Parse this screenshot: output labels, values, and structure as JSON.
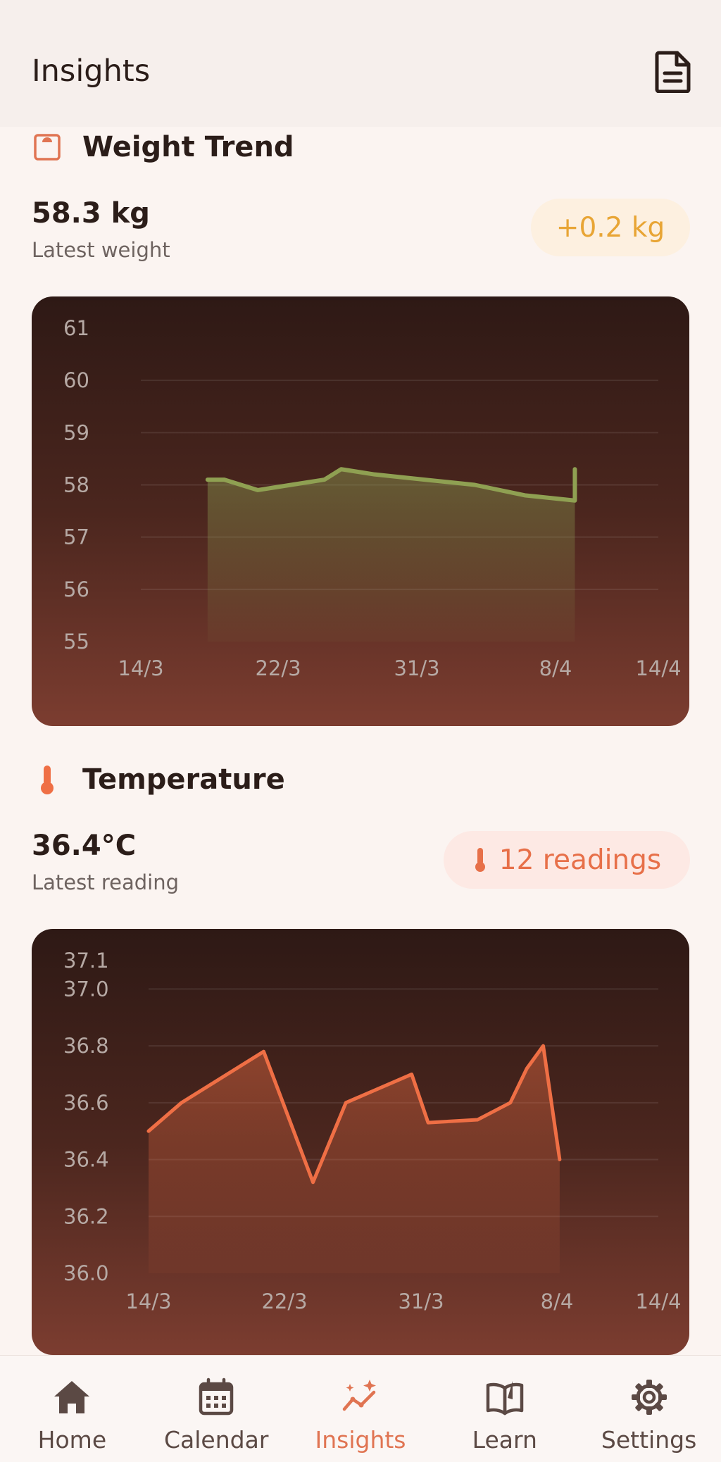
{
  "header": {
    "title": "Insights",
    "report_icon": "document-icon"
  },
  "weight": {
    "section_title": "Weight Trend",
    "icon": "scale-icon",
    "value": "58.3 kg",
    "label": "Latest weight",
    "change_badge": "+0.2 kg",
    "accent_color": "#8fa052",
    "badge_color": "#e8a535"
  },
  "temperature": {
    "section_title": "Temperature",
    "icon": "thermometer-icon",
    "value": "36.4°C",
    "label": "Latest reading",
    "readings_badge": "12 readings",
    "accent_color": "#ef6f45"
  },
  "chart_data": [
    {
      "type": "area",
      "title": "",
      "xlabel": "",
      "ylabel": "",
      "x_ticks": [
        "14/3",
        "22/3",
        "31/3",
        "8/4",
        "14/4"
      ],
      "y_ticks": [
        "61",
        "60",
        "59",
        "58",
        "57",
        "56",
        "55"
      ],
      "ylim": [
        55,
        61
      ],
      "xlim": [
        "2024-03-14",
        "2024-04-14"
      ],
      "grid": true,
      "series": [
        {
          "x": [
            "2024-03-18",
            "2024-03-19",
            "2024-03-21",
            "2024-03-23",
            "2024-03-25",
            "2024-03-26",
            "2024-03-28",
            "2024-03-31",
            "2024-04-03",
            "2024-04-06",
            "2024-04-09",
            "2024-04-09"
          ],
          "y": [
            58.1,
            58.1,
            57.9,
            58.0,
            58.1,
            58.3,
            58.2,
            58.1,
            58.0,
            57.8,
            57.7,
            58.3
          ]
        }
      ]
    },
    {
      "type": "area",
      "title": "",
      "xlabel": "",
      "ylabel": "",
      "x_ticks": [
        "14/3",
        "22/3",
        "31/3",
        "8/4",
        "14/4"
      ],
      "y_ticks": [
        "37.1",
        "37.0",
        "36.8",
        "36.6",
        "36.4",
        "36.2",
        "36.0"
      ],
      "ylim": [
        36.0,
        37.1
      ],
      "xlim": [
        "2024-03-14",
        "2024-04-14"
      ],
      "grid": true,
      "series": [
        {
          "x": [
            "2024-03-14",
            "2024-03-16",
            "2024-03-21",
            "2024-03-24",
            "2024-03-26",
            "2024-03-30",
            "2024-03-31",
            "2024-04-03",
            "2024-04-05",
            "2024-04-06",
            "2024-04-07",
            "2024-04-08"
          ],
          "y": [
            36.5,
            36.6,
            36.78,
            36.32,
            36.6,
            36.7,
            36.53,
            36.54,
            36.6,
            36.72,
            36.8,
            36.4
          ]
        }
      ]
    }
  ],
  "nav": {
    "items": [
      {
        "label": "Home",
        "icon": "home-icon"
      },
      {
        "label": "Calendar",
        "icon": "calendar-icon"
      },
      {
        "label": "Insights",
        "icon": "insights-icon"
      },
      {
        "label": "Learn",
        "icon": "book-icon"
      },
      {
        "label": "Settings",
        "icon": "gear-icon"
      }
    ],
    "active_color": "#e07452"
  }
}
